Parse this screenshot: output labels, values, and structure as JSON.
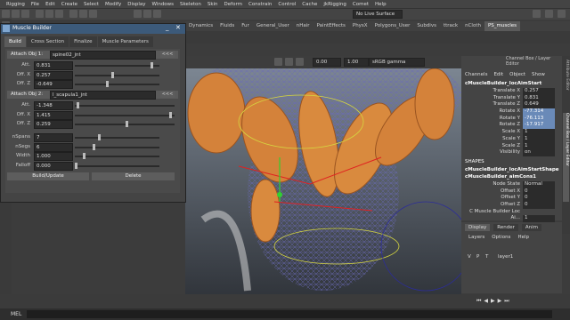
{
  "menu": [
    "Rigging",
    "File",
    "Edit",
    "Create",
    "Select",
    "Modify",
    "Display",
    "Windows",
    "Skeleton",
    "Skin",
    "Deform",
    "Constrain",
    "Control",
    "Cache",
    "jkRigging",
    "Comet",
    "Help"
  ],
  "statusline": {
    "live_surface": "No Live Surface"
  },
  "shelf_tabs": [
    "Dynamics",
    "Fluids",
    "Fur",
    "General_User",
    "nHair",
    "PaintEffects",
    "PhysX",
    "Polygons_User",
    "Subdivs",
    "ttrack",
    "nCloth",
    "PS_muscles"
  ],
  "shelf_active": "PS_muscles",
  "viewport_bar": {
    "value1": "0.00",
    "value2": "1.00",
    "colorspace": "sRGB gamma"
  },
  "muscle_builder": {
    "title": "Muscle Builder",
    "tabs": [
      "Build",
      "Cross Section",
      "Finalize",
      "Muscle Parameters"
    ],
    "active_tab": "Build",
    "attach1": {
      "label": "Attach Obj 1:",
      "value": "spine02_jnt",
      "arrows": "<<<",
      "rows": [
        {
          "label": "Att.",
          "value": "0.831",
          "pos": 0.92
        },
        {
          "label": "Off. X",
          "value": "0.257",
          "pos": 0.45
        },
        {
          "label": "Off. Z",
          "value": "-0.649",
          "pos": 0.38
        }
      ]
    },
    "attach2": {
      "label": "Attach Obj 2:",
      "value": "l_scapula1_jnt",
      "arrows": "<<<",
      "rows": [
        {
          "label": "Att.",
          "value": "-1.348",
          "pos": 0.02
        },
        {
          "label": "Off. X",
          "value": "1.415",
          "pos": 0.97
        },
        {
          "label": "Off. Z",
          "value": "0.259",
          "pos": 0.52
        }
      ]
    },
    "params": [
      {
        "label": "nSpans",
        "value": "7",
        "pos": 0.28
      },
      {
        "label": "nSegs",
        "value": "6",
        "pos": 0.22
      },
      {
        "label": "Width",
        "value": "1.000",
        "pos": 0.1
      },
      {
        "label": "Falloff",
        "value": "0.000",
        "pos": 0.0
      }
    ],
    "build_label": "Build/Update",
    "delete_label": "Delete"
  },
  "channel_box": {
    "header": "Channel Box / Layer Editor",
    "menu": [
      "Channels",
      "Edit",
      "Object",
      "Show"
    ],
    "object": "cMuscleBuilder_locAimStart",
    "channels": [
      {
        "k": "Translate X",
        "v": "0.257",
        "sel": false
      },
      {
        "k": "Translate Y",
        "v": "0.831",
        "sel": false
      },
      {
        "k": "Translate Z",
        "v": "0.649",
        "sel": false
      },
      {
        "k": "Rotate X",
        "v": "-77.314",
        "sel": true
      },
      {
        "k": "Rotate Y",
        "v": "-76.113",
        "sel": true
      },
      {
        "k": "Rotate Z",
        "v": "-17.917",
        "sel": true
      },
      {
        "k": "Scale X",
        "v": "1",
        "sel": false
      },
      {
        "k": "Scale Y",
        "v": "1",
        "sel": false
      },
      {
        "k": "Scale Z",
        "v": "1",
        "sel": false
      },
      {
        "k": "Visibility",
        "v": "on",
        "sel": false
      }
    ],
    "shapes_header": "SHAPES",
    "shapes": [
      "cMuscleBuilder_locAimStartShape",
      "cMuscleBuilder_aimCons1"
    ],
    "shape_channels": [
      {
        "k": "Node State",
        "v": "Normal"
      },
      {
        "k": "Offset X",
        "v": "0"
      },
      {
        "k": "Offset Y",
        "v": "0"
      },
      {
        "k": "Offset Z",
        "v": "0"
      },
      {
        "k": "C Muscle Builder Loc Ai...",
        "v": "1"
      }
    ]
  },
  "side_tabs": [
    "Attribute Editor",
    "Channel Box / Layer Editor"
  ],
  "layers": {
    "tabs": [
      "Display",
      "Render",
      "Anim"
    ],
    "menu": [
      "Layers",
      "Options",
      "Help"
    ],
    "row": {
      "v": "V",
      "p": "P",
      "t": "T",
      "name": "layer1"
    }
  },
  "cmd_label": "MEL"
}
